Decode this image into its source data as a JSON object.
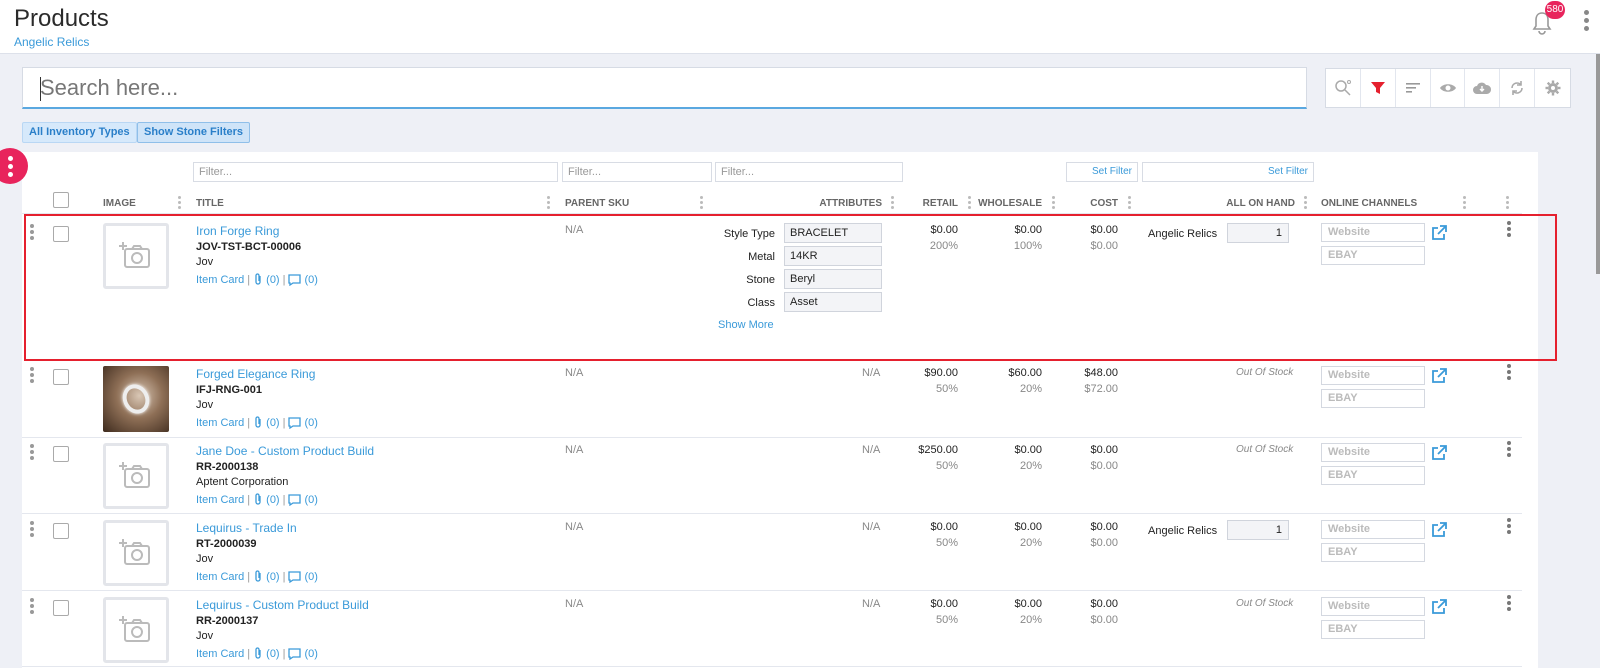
{
  "header": {
    "title": "Products",
    "subtitle": "Angelic Relics",
    "notification_count": "580"
  },
  "search": {
    "placeholder": "Search here..."
  },
  "toolbar": {
    "icons": [
      "search-settings-icon",
      "filter-icon",
      "sort-icon",
      "eye-icon",
      "cloud-download-icon",
      "refresh-icon",
      "gear-icon"
    ],
    "filter_color": "#e5202e"
  },
  "chips": {
    "inventory_types": "All Inventory Types",
    "stone_filters": "Show Stone Filters"
  },
  "filters": {
    "placeholder": "Filter...",
    "set_filter": "Set Filter"
  },
  "columns": {
    "image": "IMAGE",
    "title": "TITLE",
    "parent_sku": "PARENT SKU",
    "attributes": "ATTRIBUTES",
    "retail": "RETAIL",
    "wholesale": "WHOLESALE",
    "cost": "COST",
    "all_on_hand": "ALL ON HAND",
    "online_channels": "ONLINE CHANNELS"
  },
  "labels": {
    "item_card": "Item Card",
    "attach_count": "(0)",
    "comment_count": "(0)",
    "show_more": "Show More",
    "website": "Website",
    "ebay": "EBAY"
  },
  "rows": [
    {
      "title": "Iron Forge Ring",
      "sku": "JOV-TST-BCT-00006",
      "brand": "Jov",
      "parent_sku": "N/A",
      "attributes": [
        {
          "label": "Style Type",
          "value": "BRACELET"
        },
        {
          "label": "Metal",
          "value": "14KR"
        },
        {
          "label": "Stone",
          "value": "Beryl"
        },
        {
          "label": "Class",
          "value": "Asset"
        }
      ],
      "retail": "$0.00",
      "retail_pct": "200%",
      "wholesale": "$0.00",
      "wholesale_pct": "100%",
      "cost": "$0.00",
      "cost_sub": "$0.00",
      "location": "Angelic Relics",
      "qty": "1",
      "has_photo": false
    },
    {
      "title": "Forged Elegance Ring",
      "sku": "IFJ-RNG-001",
      "brand": "Jov",
      "parent_sku": "N/A",
      "attributes_text": "N/A",
      "retail": "$90.00",
      "retail_pct": "50%",
      "wholesale": "$60.00",
      "wholesale_pct": "20%",
      "cost": "$48.00",
      "cost_sub": "$72.00",
      "stock": "Out Of Stock",
      "has_photo": true
    },
    {
      "title": "Jane Doe - Custom Product Build",
      "sku": "RR-2000138",
      "brand": "Aptent Corporation",
      "parent_sku": "N/A",
      "attributes_text": "N/A",
      "retail": "$250.00",
      "retail_pct": "50%",
      "wholesale": "$0.00",
      "wholesale_pct": "20%",
      "cost": "$0.00",
      "cost_sub": "$0.00",
      "stock": "Out Of Stock",
      "has_photo": false
    },
    {
      "title": "Lequirus - Trade In",
      "sku": "RT-2000039",
      "brand": "Jov",
      "parent_sku": "N/A",
      "attributes_text": "N/A",
      "retail": "$0.00",
      "retail_pct": "50%",
      "wholesale": "$0.00",
      "wholesale_pct": "20%",
      "cost": "$0.00",
      "cost_sub": "$0.00",
      "location": "Angelic Relics",
      "qty": "1",
      "has_photo": false
    },
    {
      "title": "Lequirus - Custom Product Build",
      "sku": "RR-2000137",
      "brand": "Jov",
      "parent_sku": "N/A",
      "attributes_text": "N/A",
      "retail": "$0.00",
      "retail_pct": "50%",
      "wholesale": "$0.00",
      "wholesale_pct": "20%",
      "cost": "$0.00",
      "cost_sub": "$0.00",
      "stock": "Out Of Stock",
      "has_photo": false
    }
  ]
}
